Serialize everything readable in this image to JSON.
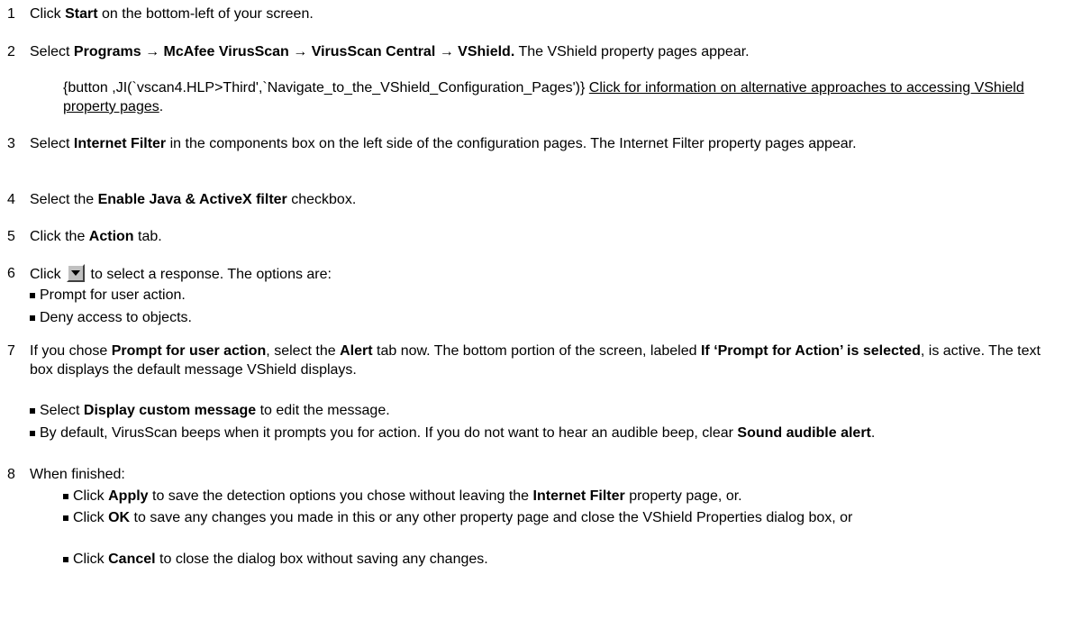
{
  "steps": {
    "s1": {
      "num": "1",
      "pre": "Click ",
      "b1": "Start",
      "post": " on the bottom-left of your screen."
    },
    "s2": {
      "num": "2",
      "pre": "Select ",
      "b1": "Programs → McAfee VirusScan → VirusScan Central → VShield.",
      "post": " The VShield property pages appear."
    },
    "s2_note": {
      "macro": "{button ,JI(`vscan4.HLP>Third',`Navigate_to_the_VShield_Configuration_Pages')} ",
      "link": "Click for information on alternative approaches to accessing VShield property pages",
      "post": "."
    },
    "s3": {
      "num": "3",
      "pre": "Select ",
      "b1": "Internet Filter",
      "post": " in the components box on the left side of the configuration pages. The Internet Filter property pages appear."
    },
    "s4": {
      "num": "4",
      "pre": "Select the ",
      "b1": "Enable Java & ActiveX filter",
      "post": " checkbox."
    },
    "s5": {
      "num": "5",
      "pre": "Click the ",
      "b1": "Action",
      "post": " tab."
    },
    "s6": {
      "num": "6",
      "pre": "Click ",
      "post": " to select a response. The options are:",
      "bullets": [
        "Prompt for user action.",
        "Deny access to objects."
      ]
    },
    "s7": {
      "num": "7",
      "pre": "If you chose ",
      "b1": "Prompt for user action",
      "mid1": ", select the ",
      "b2": "Alert",
      "mid2": " tab now. The bottom portion of the screen, labeled ",
      "b3": "If ‘Prompt for Action’ is selected",
      "post": ", is active. The text box displays the default message VShield displays."
    },
    "s7_b1": {
      "pre": "Select ",
      "b1": "Display custom message",
      "post": " to edit the message."
    },
    "s7_b2": {
      "pre": "By default, VirusScan beeps when it prompts you for action. If you do not want to hear an audible beep, clear ",
      "b1": "Sound audible alert",
      "post": "."
    },
    "s8": {
      "num": "8",
      "text": " When finished:"
    },
    "s8_b1": {
      "pre": "Click ",
      "b1": "Apply",
      "mid": " to save the detection options you chose without leaving the ",
      "b2": "Internet Filter",
      "post": " property page, or."
    },
    "s8_b2": {
      "pre": "Click ",
      "b1": "OK",
      "post": " to save any changes you made in this or any other property page and close the VShield Properties dialog box, or"
    },
    "s8_b3": {
      "pre": "Click ",
      "b1": "Cancel",
      "post": " to close the dialog box without saving any changes."
    }
  },
  "icons": {
    "dropdown_button": "dropdown-arrow-icon"
  }
}
